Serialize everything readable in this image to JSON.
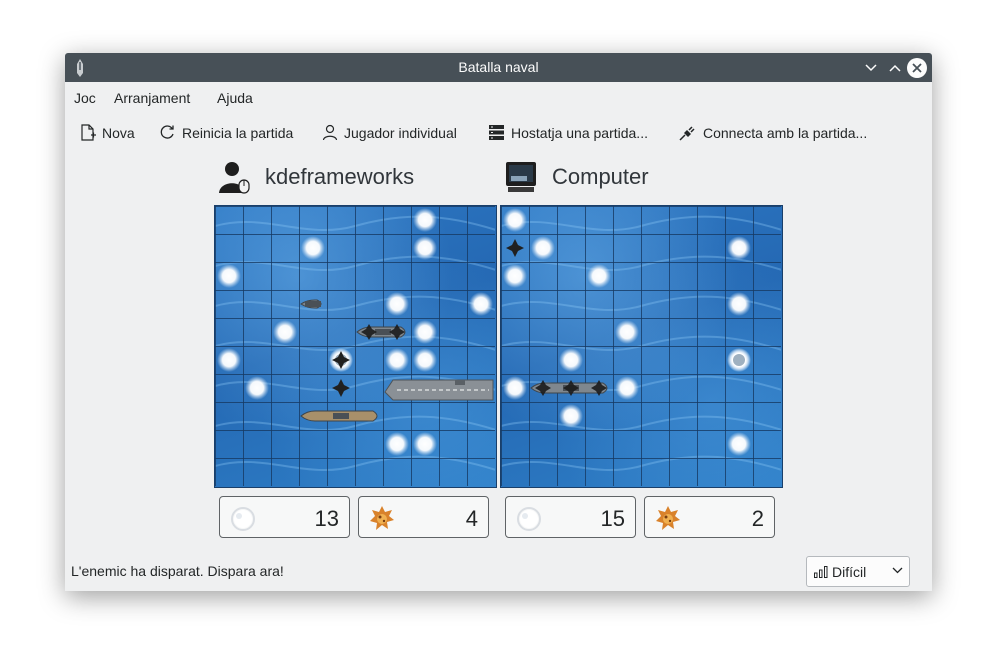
{
  "window": {
    "title": "Batalla naval"
  },
  "menu": [
    "Joc",
    "Arranjament",
    "Ajuda"
  ],
  "toolbar": {
    "new": "Nova",
    "restart": "Reinicia la partida",
    "single": "Jugador individual",
    "host": "Hostatja una partida...",
    "connect": "Connecta amb la partida..."
  },
  "players": {
    "left": {
      "name": "kdeframeworks",
      "misses": "13",
      "hits": "4"
    },
    "right": {
      "name": "Computer",
      "misses": "15",
      "hits": "2"
    }
  },
  "status": "L'enemic ha disparat. Dispara ara!",
  "difficulty": "Difícil",
  "colors": {
    "titlebar": "#475057",
    "window_bg": "#eff0f1",
    "water": "#2a70bc",
    "grid": "#173a63"
  },
  "boards": {
    "size": 10,
    "left": {
      "misses": [
        [
          7,
          0
        ],
        [
          7,
          1
        ],
        [
          0,
          2
        ],
        [
          6,
          3
        ],
        [
          9,
          3
        ],
        [
          2,
          4
        ],
        [
          7,
          4
        ],
        [
          0,
          5
        ],
        [
          4,
          5
        ],
        [
          6,
          5
        ],
        [
          7,
          5
        ],
        [
          1,
          6
        ],
        [
          3,
          1
        ],
        [
          6,
          8
        ],
        [
          7,
          8
        ]
      ],
      "ships": [
        {
          "kind": "small",
          "row": 3,
          "col": 3,
          "len": 1
        },
        {
          "kind": "damaged",
          "row": 4,
          "col": 5,
          "len": 2,
          "hits": [
            0,
            1
          ]
        },
        {
          "kind": "carrier",
          "row": 6,
          "col": 6,
          "len": 4
        },
        {
          "kind": "battleship",
          "row": 7,
          "col": 3,
          "len": 3
        }
      ],
      "hits": [
        [
          4,
          5
        ],
        [
          4,
          6
        ]
      ],
      "splash": [
        [
          4,
          5
        ]
      ]
    },
    "right": {
      "misses": [
        [
          0,
          0
        ],
        [
          1,
          1
        ],
        [
          8,
          1
        ],
        [
          0,
          2
        ],
        [
          3,
          2
        ],
        [
          8,
          3
        ],
        [
          4,
          4
        ],
        [
          2,
          5
        ],
        [
          8,
          5
        ],
        [
          0,
          6
        ],
        [
          4,
          6
        ],
        [
          2,
          7
        ],
        [
          8,
          8
        ]
      ],
      "ships": [
        {
          "kind": "sunk-right",
          "row": 6,
          "col": 1,
          "len": 3,
          "hits": [
            0,
            1,
            2
          ]
        }
      ],
      "hits": [
        [
          0,
          1
        ]
      ],
      "splash": [
        [
          8,
          5
        ]
      ]
    }
  }
}
